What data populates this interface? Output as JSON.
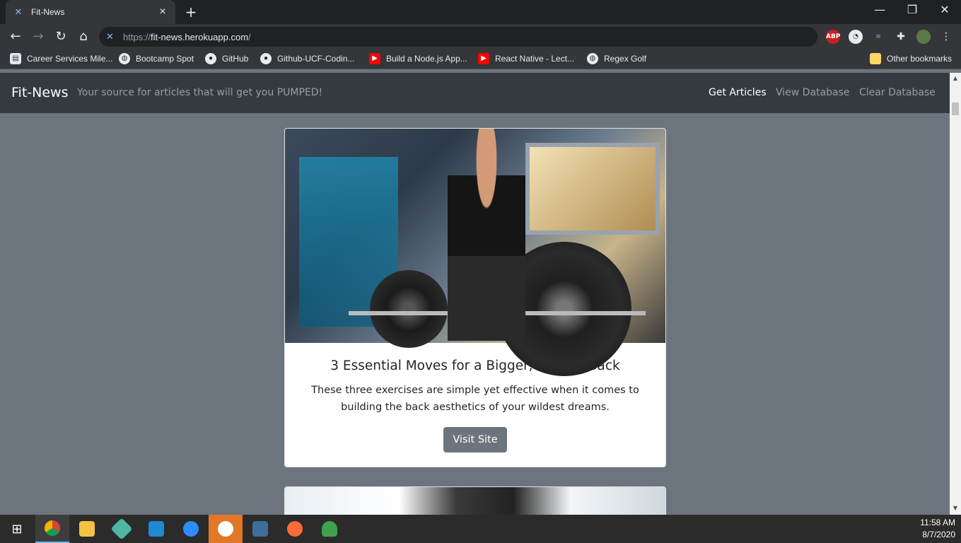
{
  "browser": {
    "tab_title": "Fit-News",
    "url_prefix": "https://",
    "url_host": "fit-news.herokuapp.com",
    "url_path": "/",
    "bookmarks": [
      {
        "label": "Career Services Mile...",
        "icon": "career-icon"
      },
      {
        "label": "Bootcamp Spot",
        "icon": "globe-icon"
      },
      {
        "label": "GitHub",
        "icon": "github-icon"
      },
      {
        "label": "Github-UCF-Codin...",
        "icon": "github-icon"
      },
      {
        "label": "Build a Node.js App...",
        "icon": "youtube-icon"
      },
      {
        "label": "React Native - Lect...",
        "icon": "youtube-icon"
      },
      {
        "label": "Regex Golf",
        "icon": "globe-icon"
      }
    ],
    "other_bookmarks": "Other bookmarks",
    "ext_abp": "ABP"
  },
  "site": {
    "brand": "Fit-News",
    "tagline": "Your source for articles that will get you PUMPED!",
    "nav": [
      "Get Articles",
      "View Database",
      "Clear Database"
    ]
  },
  "articles": [
    {
      "title": "3 Essential Moves for a Bigger, Badder Back",
      "summary": "These three exercises are simple yet effective when it comes to building the back aesthetics of your wildest dreams.",
      "button": "Visit Site"
    }
  ],
  "taskbar": {
    "time": "11:58 AM",
    "date": "8/7/2020"
  },
  "colors": {
    "page_bg": "#6c757d",
    "navbar_bg": "#343a40",
    "button_bg": "#6c757d"
  }
}
